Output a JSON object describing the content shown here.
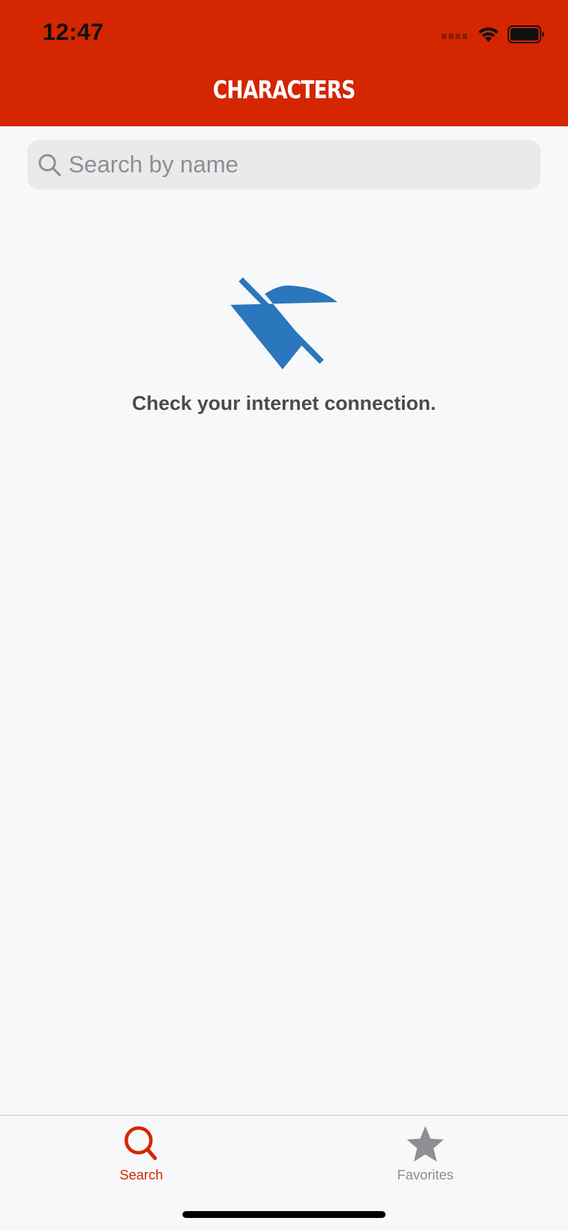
{
  "status_bar": {
    "time": "12:47",
    "icons": [
      "cellular-signal-icon",
      "wifi-icon",
      "battery-icon"
    ]
  },
  "nav": {
    "title": "CHARACTERS"
  },
  "search": {
    "placeholder": "Search by name",
    "value": "",
    "icon": "search-icon"
  },
  "empty_state": {
    "icon": "wifi-off-icon",
    "message": "Check your internet connection."
  },
  "tabbar": {
    "tabs": [
      {
        "label": "Search",
        "icon": "search-icon",
        "selected": true
      },
      {
        "label": "Favorites",
        "icon": "star-icon",
        "selected": false
      }
    ]
  },
  "colors": {
    "header": "#d42600",
    "accent": "#d42600",
    "offline_icon": "#2b77bd",
    "inactive_tab": "#8e8e93",
    "background": "#f7f8f9"
  }
}
